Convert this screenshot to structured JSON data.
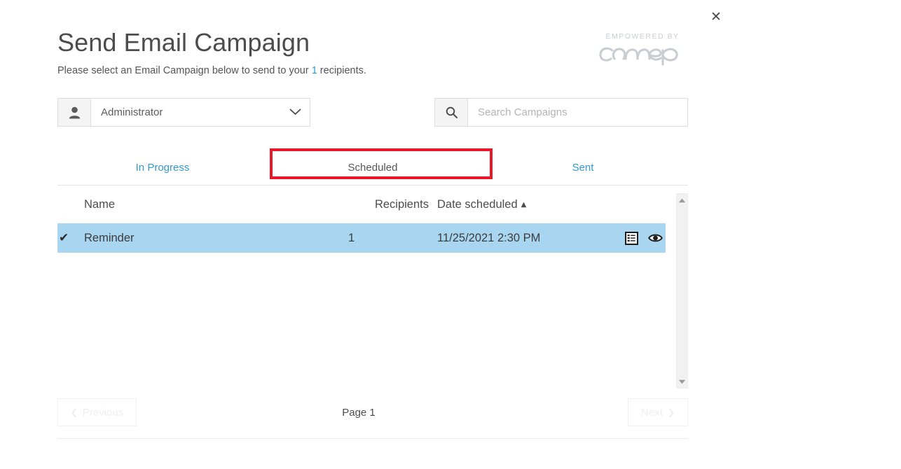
{
  "window": {
    "close_label": "✕"
  },
  "header": {
    "title": "Send Email Campaign",
    "subtitle_before": "Please select an Email Campaign below to send to your ",
    "subtitle_count": "1",
    "subtitle_after": " recipients."
  },
  "logo": {
    "kicker": "EMPOWERED BY",
    "wordmark": "concep",
    "color": "#c9cdd2"
  },
  "filters": {
    "user": {
      "icon": "person-icon",
      "value": "Administrator",
      "chevron": "chevron-down-icon"
    },
    "search": {
      "icon": "search-icon",
      "placeholder": "Search Campaigns",
      "value": ""
    }
  },
  "tabs": [
    {
      "id": "in-progress",
      "label": "In Progress",
      "active": false
    },
    {
      "id": "scheduled",
      "label": "Scheduled",
      "active": true
    },
    {
      "id": "sent",
      "label": "Sent",
      "active": false
    }
  ],
  "highlight": {
    "target_tab": "scheduled",
    "color": "#e8172a"
  },
  "table": {
    "columns": [
      "Name",
      "Recipients",
      "Date scheduled"
    ],
    "sort": {
      "column": "Date scheduled",
      "direction": "asc",
      "caret": "▲"
    },
    "rows": [
      {
        "selected": true,
        "check": "✔",
        "name": "Reminder",
        "recipients": "1",
        "date_scheduled": "11/25/2021 2:30 PM",
        "actions": [
          "report-icon",
          "preview-eye-icon"
        ]
      }
    ],
    "selected_row_color": "#a8d5ef"
  },
  "pagination": {
    "previous_label": "Previous",
    "previous_arrow": "❮",
    "previous_disabled": true,
    "page_label": "Page 1",
    "next_label": "Next",
    "next_arrow": "❯",
    "next_disabled": true
  },
  "theme": {
    "link_color": "#3699d3",
    "text_color": "#4c4c4c",
    "border_color": "#dddddd"
  }
}
